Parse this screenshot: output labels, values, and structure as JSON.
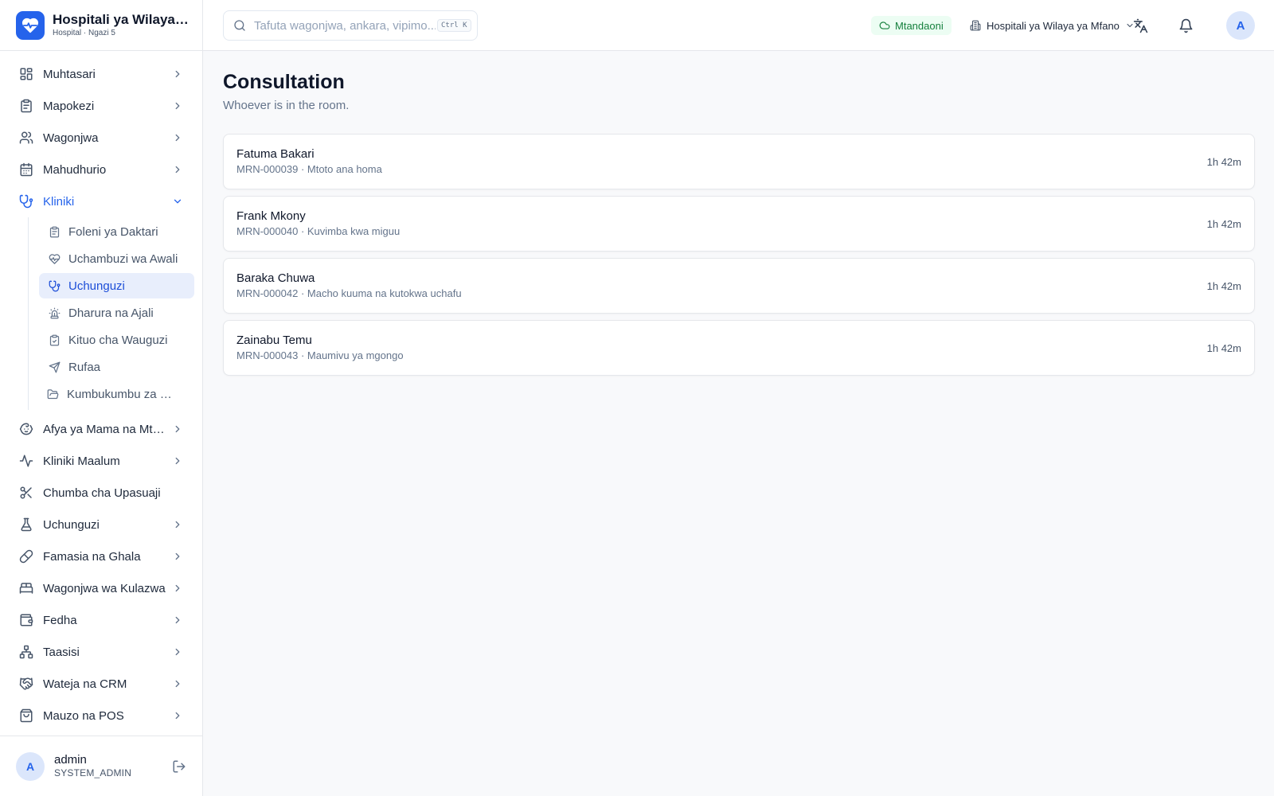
{
  "brand": {
    "name": "Hospitali ya Wilaya ya Mfano",
    "subtitle": "Hospital · Ngazi 5"
  },
  "sidebar": {
    "items": [
      {
        "label": "Muhtasari",
        "icon": "grid-icon"
      },
      {
        "label": "Mapokezi",
        "icon": "clipboard-icon"
      },
      {
        "label": "Wagonjwa",
        "icon": "users-icon"
      },
      {
        "label": "Mahudhurio",
        "icon": "calendar-icon"
      },
      {
        "label": "Kliniki",
        "icon": "stethoscope-icon",
        "expanded": true
      }
    ],
    "sub_items": [
      {
        "label": "Foleni ya Daktari",
        "icon": "clipboard-icon"
      },
      {
        "label": "Uchambuzi wa Awali",
        "icon": "heart-pulse-icon"
      },
      {
        "label": "Uchunguzi",
        "icon": "stethoscope-icon",
        "active": true
      },
      {
        "label": "Dharura na Ajali",
        "icon": "siren-icon"
      },
      {
        "label": "Kituo cha Wauguzi",
        "icon": "clipboard-check-icon"
      },
      {
        "label": "Rufaa",
        "icon": "send-icon"
      },
      {
        "label": "Kumbukumbu za Matibabu",
        "icon": "folder-icon"
      }
    ],
    "items_after": [
      {
        "label": "Afya ya Mama na Mtoto",
        "icon": "baby-icon"
      },
      {
        "label": "Kliniki Maalum",
        "icon": "activity-icon"
      },
      {
        "label": "Chumba cha Upasuaji",
        "icon": "scissors-icon"
      },
      {
        "label": "Uchunguzi",
        "icon": "flask-icon"
      },
      {
        "label": "Famasia na Ghala",
        "icon": "pill-icon"
      },
      {
        "label": "Wagonjwa wa Kulazwa",
        "icon": "bed-icon"
      },
      {
        "label": "Fedha",
        "icon": "wallet-icon"
      },
      {
        "label": "Taasisi",
        "icon": "network-icon"
      },
      {
        "label": "Wateja na CRM",
        "icon": "handshake-icon"
      },
      {
        "label": "Mauzo na POS",
        "icon": "shopping-bag-icon"
      }
    ]
  },
  "user": {
    "initial": "A",
    "name": "admin",
    "role": "SYSTEM_ADMIN"
  },
  "topbar": {
    "search_placeholder": "Tafuta wagonjwa, ankara, vipimo...",
    "shortcut": "Ctrl K",
    "status": "Mtandaoni",
    "facility": "Hospitali ya Wilaya ya Mfano",
    "avatar_initial": "A"
  },
  "page": {
    "title": "Consultation",
    "subtitle": "Whoever is in the room."
  },
  "patients": [
    {
      "name": "Fatuma Bakari",
      "mrn": "MRN-000039",
      "complaint": "Mtoto ana homa",
      "wait": "1h 42m"
    },
    {
      "name": "Frank Mkony",
      "mrn": "MRN-000040",
      "complaint": "Kuvimba kwa miguu",
      "wait": "1h 42m"
    },
    {
      "name": "Baraka Chuwa",
      "mrn": "MRN-000042",
      "complaint": "Macho kuuma na kutokwa uchafu",
      "wait": "1h 42m"
    },
    {
      "name": "Zainabu Temu",
      "mrn": "MRN-000043",
      "complaint": "Maumivu ya mgongo",
      "wait": "1h 42m"
    }
  ],
  "colors": {
    "accent": "#2563eb",
    "online": "#15803d",
    "active_bg": "#e8eefc"
  }
}
